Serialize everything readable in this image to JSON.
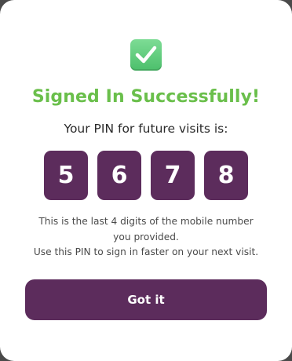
{
  "icon": {
    "name": "check-mark-button-icon",
    "color": "#5cc97a"
  },
  "title": "Signed In Successfully!",
  "subtitle": "Your PIN for future visits is:",
  "pin": [
    "5",
    "6",
    "7",
    "8"
  ],
  "info": {
    "line1": "This is the last 4 digits of the mobile number",
    "line2": "you provided.",
    "line3": "Use this PIN to sign in faster on your next visit."
  },
  "button": {
    "label": "Got it"
  },
  "colors": {
    "title_green": "#6abf4b",
    "brand_purple": "#5c2c5c"
  }
}
